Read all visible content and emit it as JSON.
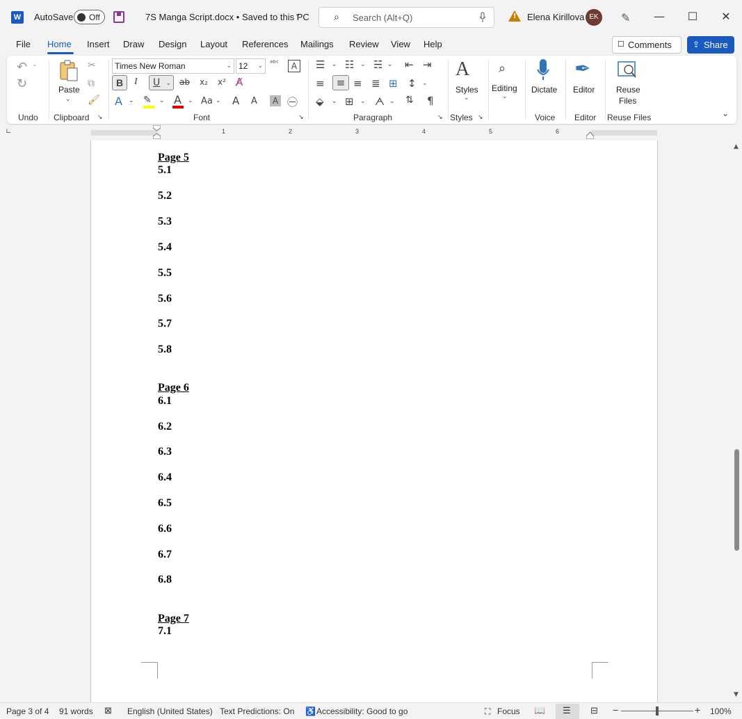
{
  "titlebar": {
    "app_icon": "W",
    "autosave_label": "AutoSave",
    "autosave_state": "Off",
    "doc_title": "7S Manga Script.docx • Saved to this PC",
    "search_placeholder": "Search (Alt+Q)",
    "user_name": "Elena Kirillova",
    "user_initials": "EK"
  },
  "menu": {
    "items": [
      "File",
      "Home",
      "Insert",
      "Draw",
      "Design",
      "Layout",
      "References",
      "Mailings",
      "Review",
      "View",
      "Help"
    ],
    "active": "Home",
    "comments_label": "Comments",
    "share_label": "Share"
  },
  "ribbon": {
    "groups": {
      "undo": "Undo",
      "clipboard": "Clipboard",
      "font": "Font",
      "paragraph": "Paragraph",
      "styles": "Styles",
      "voice": "Voice",
      "editor": "Editor",
      "reuse": "Reuse Files"
    },
    "font_name": "Times New Roman",
    "font_size": "12",
    "paste_label": "Paste",
    "styles_label": "Styles",
    "editing_label": "Editing",
    "dictate_label": "Dictate",
    "editor_label": "Editor",
    "reuse_label_1": "Reuse",
    "reuse_label_2": "Files",
    "bold": "B",
    "italic": "I",
    "underline": "U",
    "strike": "ab",
    "subscript": "x₂",
    "superscript": "x²",
    "change_case": "Aa",
    "grow": "A",
    "shrink": "A"
  },
  "ruler": {
    "numbers": [
      "1",
      "2",
      "3",
      "4",
      "5",
      "6"
    ]
  },
  "document": {
    "lines": [
      {
        "text": "Page 5",
        "heading": true
      },
      {
        "text": "5.1"
      },
      {
        "text": "5.2"
      },
      {
        "text": "5.3"
      },
      {
        "text": "5.4"
      },
      {
        "text": "5.5"
      },
      {
        "text": "5.6"
      },
      {
        "text": "5.7"
      },
      {
        "text": "5.8"
      },
      {
        "text": "Page 6",
        "heading": true
      },
      {
        "text": "6.1"
      },
      {
        "text": "6.2"
      },
      {
        "text": "6.3"
      },
      {
        "text": "6.4"
      },
      {
        "text": "6.5"
      },
      {
        "text": "6.6"
      },
      {
        "text": "6.7"
      },
      {
        "text": "6.8"
      },
      {
        "text": "Page 7",
        "heading": true
      },
      {
        "text": "7.1"
      }
    ]
  },
  "status": {
    "page": "Page 3 of 4",
    "words": "91 words",
    "language": "English (United States)",
    "predictions": "Text Predictions: On",
    "accessibility": "Accessibility: Good to go",
    "focus": "Focus",
    "zoom": "100%",
    "zoom_fraction": 0.5
  },
  "colors": {
    "accent": "#185abd",
    "avatar": "#6e3a32",
    "warning": "#c67f00"
  }
}
